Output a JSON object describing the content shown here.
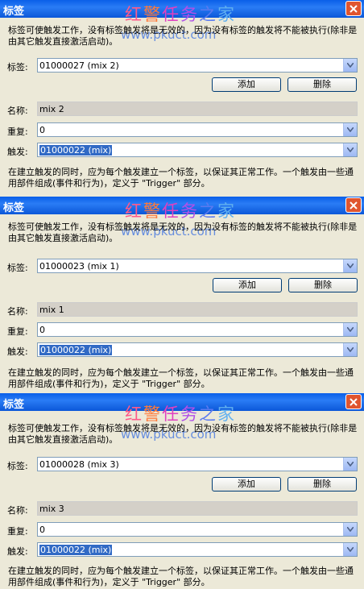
{
  "dialogs": [
    {
      "title": "标签",
      "watermark": [
        "红",
        "警",
        "任",
        "务",
        "之",
        "家"
      ],
      "watermark_url": "www.pkuct.com",
      "description": "标签可使触发工作，没有标签触发将是无效的，因为没有标签的触发将不能被执行(除非是由其它触发直接激活启动)。",
      "tag_label": "标签:",
      "tag_value": "01000027 (mix 2)",
      "add_button": "添加",
      "delete_button": "删除",
      "name_label": "名称:",
      "name_value": "mix 2",
      "repeat_label": "重复:",
      "repeat_value": "0",
      "trigger_label": "触发:",
      "trigger_value": "01000022 (mix)",
      "footer": "在建立触发的同时，应为每个触发建立一个标签，以保证其正常工作。一个触发由一些通用部件组成(事件和行为)，定义于 \"Trigger\" 部分。"
    },
    {
      "title": "标签",
      "watermark": [
        "红",
        "警",
        "任",
        "务",
        "之",
        "家"
      ],
      "watermark_url": "www.pkuct.com",
      "description": "标签可使触发工作，没有标签触发将是无效的，因为没有标签的触发将不能被执行(除非是由其它触发直接激活启动)。",
      "tag_label": "标签:",
      "tag_value": "01000023 (mix 1)",
      "add_button": "添加",
      "delete_button": "删除",
      "name_label": "名称:",
      "name_value": "mix 1",
      "repeat_label": "重复:",
      "repeat_value": "0",
      "trigger_label": "触发:",
      "trigger_value": "01000022 (mix)",
      "footer": "在建立触发的同时，应为每个触发建立一个标签，以保证其正常工作。一个触发由一些通用部件组成(事件和行为)，定义于 \"Trigger\" 部分。"
    },
    {
      "title": "标签",
      "watermark": [
        "红",
        "警",
        "任",
        "务",
        "之",
        "家"
      ],
      "watermark_url": "www.pkuct.com",
      "description": "标签可使触发工作，没有标签触发将是无效的，因为没有标签的触发将不能被执行(除非是由其它触发直接激活启动)。",
      "tag_label": "标签:",
      "tag_value": "01000028 (mix 3)",
      "add_button": "添加",
      "delete_button": "删除",
      "name_label": "名称:",
      "name_value": "mix 3",
      "repeat_label": "重复:",
      "repeat_value": "0",
      "trigger_label": "触发:",
      "trigger_value": "01000022 (mix)",
      "footer": "在建立触发的同时，应为每个触发建立一个标签，以保证其正常工作。一个触发由一些通用部件组成(事件和行为)，定义于 \"Trigger\" 部分。"
    }
  ],
  "icons": {
    "close": "close-icon",
    "dropdown": "chevron-down-icon"
  },
  "colors": {
    "titlebar": "#0a5fe8",
    "close": "#e0552f",
    "selection": "#316ac5",
    "dialog_bg": "#ece9d8"
  }
}
